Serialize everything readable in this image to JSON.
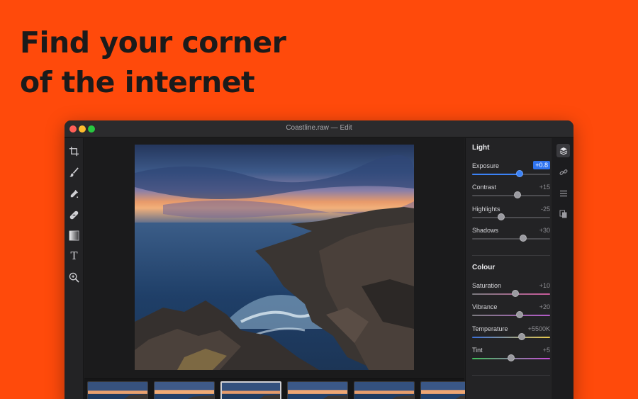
{
  "headline": {
    "line1": "Find your corner",
    "line2": "of the internet"
  },
  "window": {
    "title": "Coastline.raw — Edit"
  },
  "tools": [
    {
      "name": "crop-tool",
      "icon": "crop-icon"
    },
    {
      "name": "brush-tool",
      "icon": "brush-icon"
    },
    {
      "name": "eyedropper-tool",
      "icon": "eyedropper-icon"
    },
    {
      "name": "heal-tool",
      "icon": "bandage-icon"
    },
    {
      "name": "gradient-tool",
      "icon": "gradient-icon"
    },
    {
      "name": "text-tool",
      "icon": "text-icon",
      "glyph": "T"
    },
    {
      "name": "zoom-tool",
      "icon": "zoom-icon"
    }
  ],
  "panel": {
    "light": {
      "title": "Light",
      "exposure": {
        "label": "Exposure",
        "value": "+0.8",
        "level": 0.61
      },
      "contrast": {
        "label": "Contrast",
        "value": "+15",
        "level": 0.58
      },
      "highlights": {
        "label": "Highlights",
        "value": "-25",
        "level": 0.37
      },
      "shadows": {
        "label": "Shadows",
        "value": "+30",
        "level": 0.65
      }
    },
    "colour": {
      "title": "Colour",
      "saturation": {
        "label": "Saturation",
        "value": "+10",
        "level": 0.55
      },
      "vibrance": {
        "label": "Vibrance",
        "value": "+20",
        "level": 0.61
      },
      "temperature": {
        "label": "Temperature",
        "value": "+5500K",
        "level": 0.64
      },
      "tint": {
        "label": "Tint",
        "value": "+5",
        "level": 0.5
      }
    }
  },
  "side_icons": [
    "layers-icon",
    "link-icon",
    "list-icon",
    "copy-icon"
  ],
  "filmstrip": {
    "count": 6,
    "selected_index": 2
  },
  "colors": {
    "background": "#ff4a0b",
    "accent": "#2f73ee",
    "window": "#1e1e1f"
  }
}
